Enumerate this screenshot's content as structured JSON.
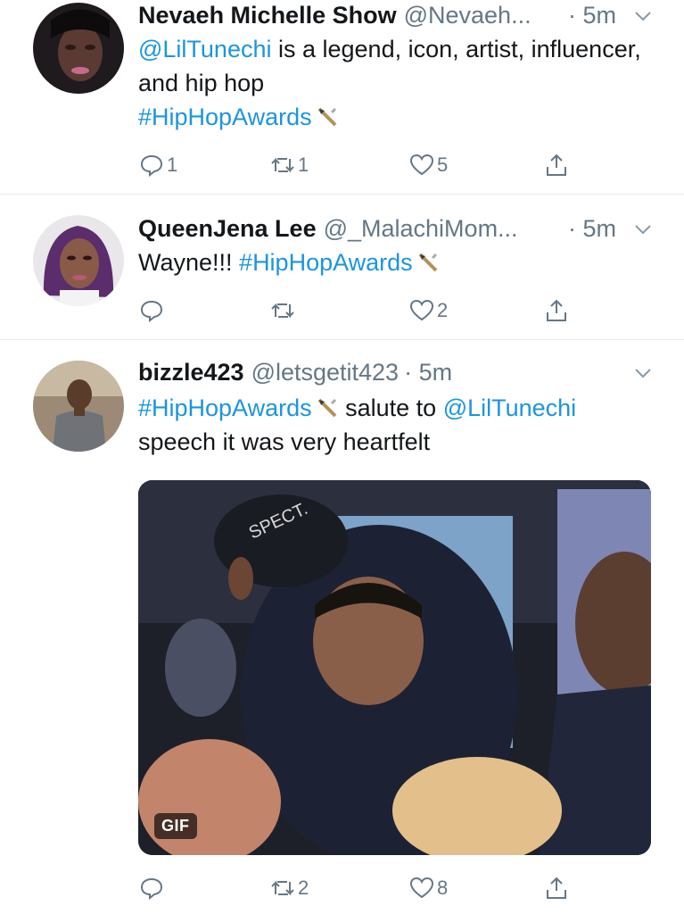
{
  "tweets": [
    {
      "name": "Nevaeh Michelle Show",
      "handle": "@Nevaeh...",
      "time": "· 5m",
      "text_parts": [
        "@LilTunechi",
        " is a legend, icon, artist, influencer,  and hip hop ",
        "#HipHopAwards"
      ],
      "counts": {
        "reply": "1",
        "retweet": "1",
        "like": "5"
      }
    },
    {
      "name": "QueenJena Lee",
      "handle": "@_MalachiMom...",
      "time": "· 5m",
      "text_parts": [
        "Wayne!!! ",
        "#HipHopAwards"
      ],
      "counts": {
        "reply": "",
        "retweet": "",
        "like": "2"
      }
    },
    {
      "name": "bizzle423",
      "handle": "@letsgetit423",
      "time": "· 5m",
      "text_parts": [
        "#HipHopAwards",
        " salute to ",
        "@LilTunechi",
        " speech it was very heartfelt"
      ],
      "media_badge": "GIF",
      "media_cap_text": "SPECT.",
      "counts": {
        "reply": "",
        "retweet": "2",
        "like": "8"
      }
    }
  ],
  "colors": {
    "link": "#1b95e0",
    "muted": "#657786",
    "divider": "#e6ecf0"
  },
  "icons": [
    "reply-icon",
    "retweet-icon",
    "like-icon",
    "share-icon",
    "chevron-down-icon",
    "bet-award-emoji"
  ]
}
